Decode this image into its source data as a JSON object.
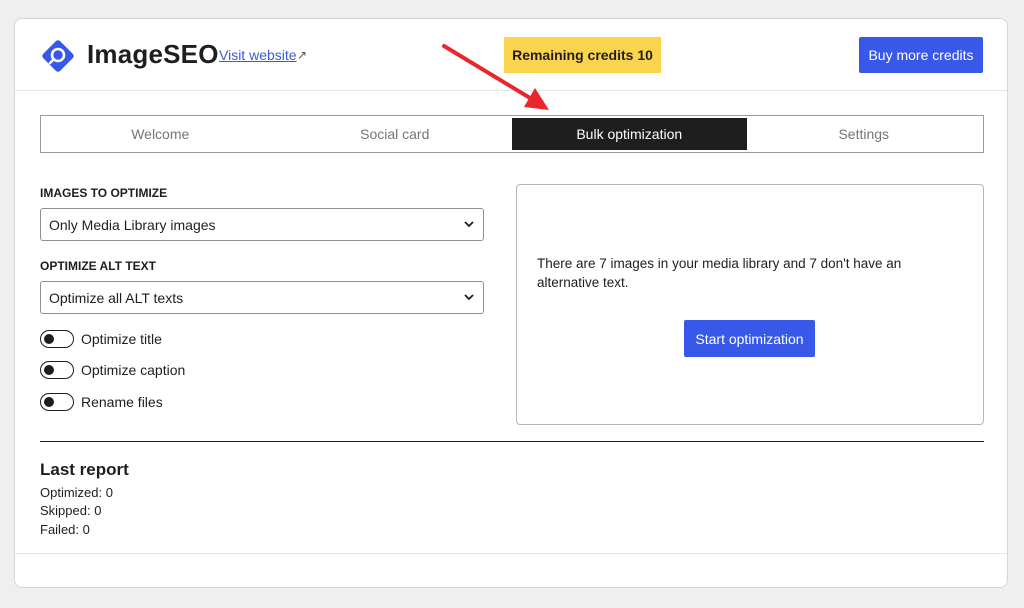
{
  "header": {
    "logo_text": "ImageSEO",
    "visit_link": "Visit website",
    "ext_icon": "↗",
    "credits_badge": "Remaining credits 10",
    "buy_button": "Buy more credits"
  },
  "tabs": [
    {
      "label": "Welcome",
      "active": false
    },
    {
      "label": "Social card",
      "active": false
    },
    {
      "label": "Bulk optimization",
      "active": true
    },
    {
      "label": "Settings",
      "active": false
    }
  ],
  "form": {
    "images_label": "IMAGES TO OPTIMIZE",
    "images_value": "Only Media Library images",
    "alt_label": "OPTIMIZE ALT TEXT",
    "alt_value": "Optimize all ALT texts",
    "toggles": [
      {
        "label": "Optimize title",
        "on": false
      },
      {
        "label": "Optimize caption",
        "on": false
      },
      {
        "label": "Rename files",
        "on": false
      }
    ]
  },
  "panel": {
    "message": "There are 7 images in your media library and 7 don't have an alternative text.",
    "start_button": "Start optimization"
  },
  "report": {
    "title": "Last report",
    "optimized": "Optimized: 0",
    "skipped": "Skipped: 0",
    "failed": "Failed: 0"
  },
  "colors": {
    "accent": "#3858e9",
    "badge": "#fcd34d",
    "annotation_arrow": "#e8262b"
  },
  "icons": {
    "logo": "imageseo-logo-icon",
    "external": "external-link-icon",
    "select_chevron": "chevron-down-icon",
    "annotation": "red-arrow-icon"
  }
}
